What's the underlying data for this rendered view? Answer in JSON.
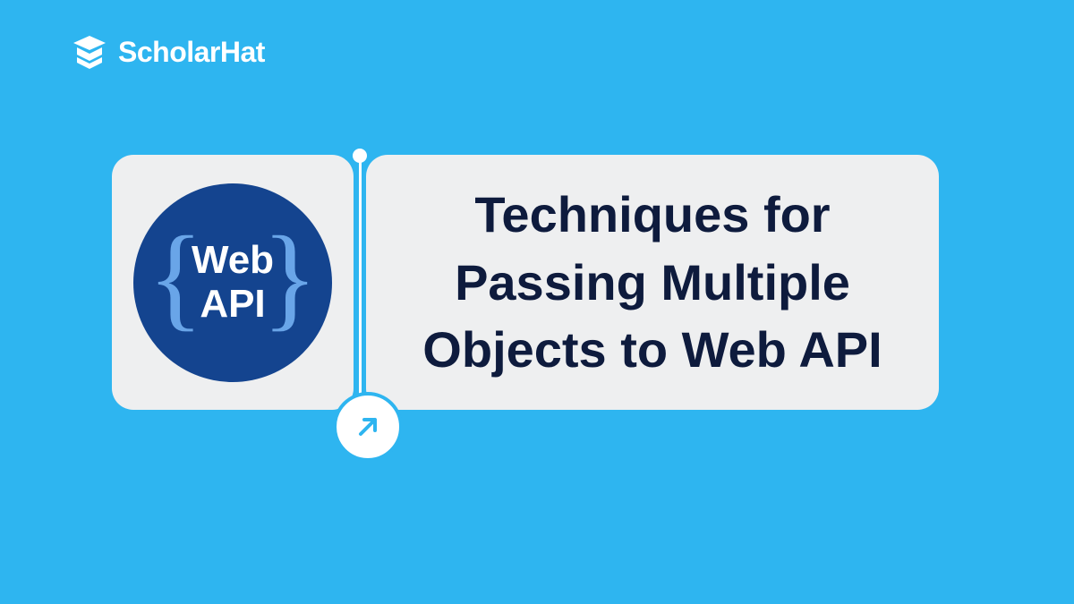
{
  "brand": {
    "name": "ScholarHat"
  },
  "leftCard": {
    "badge": {
      "line1": "Web",
      "line2": "API",
      "braceLeft": "{",
      "braceRight": "}"
    }
  },
  "rightCard": {
    "title": "Techniques for Passing Multiple Objects to Web API"
  },
  "colors": {
    "background": "#2EB5F0",
    "cardBackground": "#EEEFF0",
    "circleBackground": "#14448F",
    "titleText": "#0E1B3D",
    "braceColor": "#69A5E8"
  }
}
